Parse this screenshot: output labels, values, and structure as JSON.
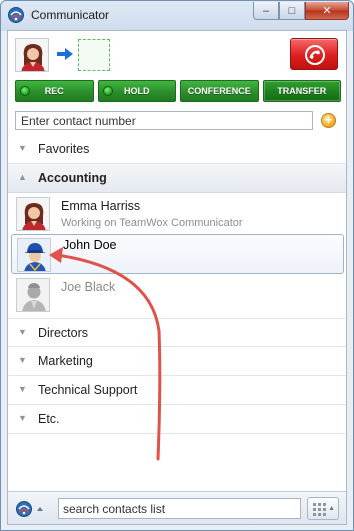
{
  "window": {
    "title": "Communicator",
    "controls": {
      "minimize": "–",
      "maximize": "□",
      "close": "✕"
    }
  },
  "call_panel": {
    "hangup_icon": "hangup-phone-icon",
    "buttons": [
      {
        "label": "REC",
        "led": true,
        "active": false
      },
      {
        "label": "HOLD",
        "led": true,
        "active": false
      },
      {
        "label": "CONFERENCE",
        "led": false,
        "active": false
      },
      {
        "label": "TRANSFER",
        "led": false,
        "active": true
      }
    ]
  },
  "contact_number": {
    "placeholder": "Enter contact number",
    "value": ""
  },
  "add_contact_icon": "+",
  "groups": {
    "favorites": {
      "label": "Favorites",
      "expanded": false
    },
    "accounting": {
      "label": "Accounting",
      "expanded": true,
      "contacts": [
        {
          "name": "Emma Harriss",
          "status": "Working on TeamWox Communicator",
          "avatar": "female-user-avatar",
          "online": true,
          "selected": false
        },
        {
          "name": "John Doe",
          "status": "",
          "avatar": "blue-hat-user-avatar",
          "online": true,
          "selected": true
        },
        {
          "name": "Joe Black",
          "status": "",
          "avatar": "grey-user-avatar",
          "online": false,
          "selected": false
        }
      ]
    },
    "collapsed": [
      {
        "label": "Directors"
      },
      {
        "label": "Marketing"
      },
      {
        "label": "Technical Support"
      },
      {
        "label": "Etc."
      }
    ]
  },
  "search": {
    "placeholder": "search contacts list",
    "value": ""
  },
  "colors": {
    "action_green": "#2b8e2b",
    "hangup_red": "#dc1f1f",
    "annotation_arrow": "#e0534a",
    "transfer_arrow": "#1a6fd8"
  }
}
